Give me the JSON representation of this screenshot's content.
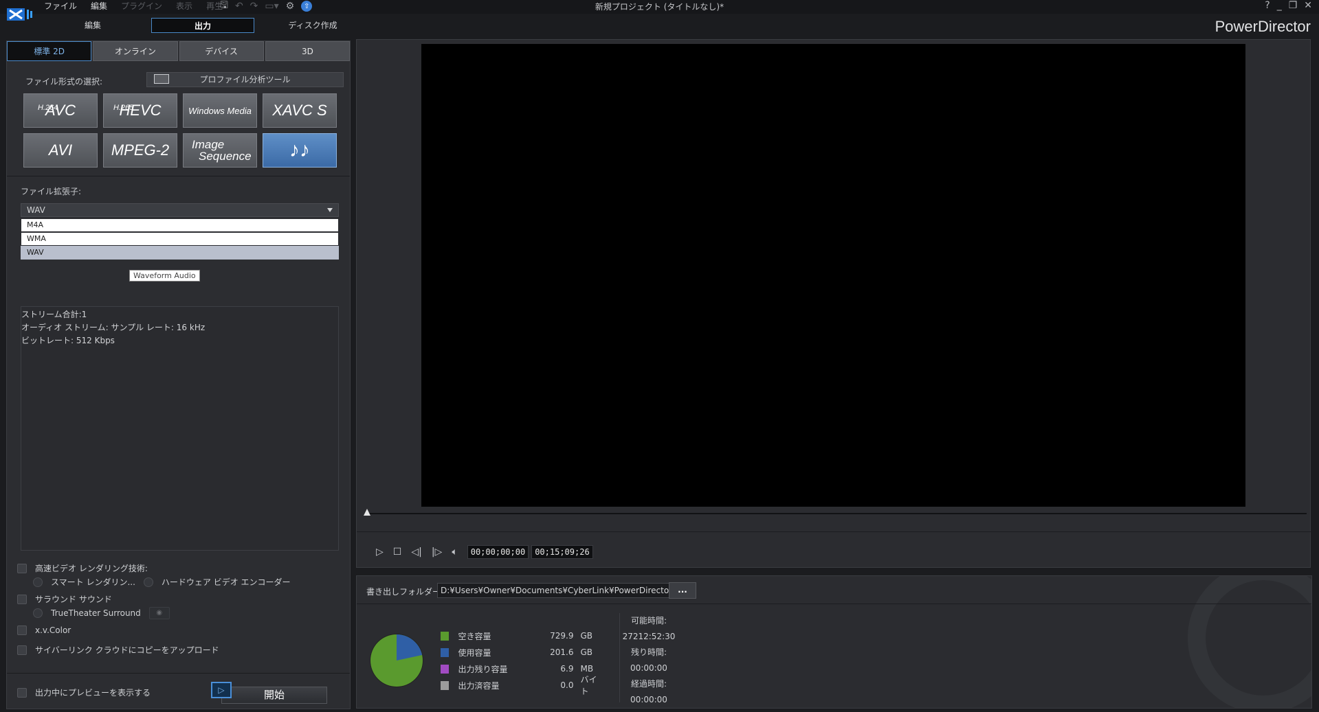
{
  "titlebar": {
    "menu": [
      "ファイル",
      "編集",
      "プラグイン",
      "表示",
      "再生"
    ],
    "document_title": "新規プロジェクト (タイトルなし)*",
    "brand": "PowerDirector",
    "window_buttons": [
      "?",
      "_",
      "❐",
      "✕"
    ]
  },
  "modes": {
    "edit": "編集",
    "produce": "出力",
    "disc": "ディスク作成"
  },
  "tabs": [
    "標準 2D",
    "オンライン",
    "デバイス",
    "3D"
  ],
  "format_section": {
    "label": "ファイル形式の選択:",
    "profile_tool": "プロファイル分析ツール",
    "formats": [
      {
        "sup": "H.264",
        "name": "AVC"
      },
      {
        "sup": "H.265",
        "name": "HEVC"
      },
      {
        "sup": "",
        "name": "Windows Media"
      },
      {
        "sup": "",
        "name": "XAVC S"
      },
      {
        "sup": "",
        "name": "AVI"
      },
      {
        "sup": "",
        "name": "MPEG-2"
      },
      {
        "sup": "",
        "name": "Image",
        "name2": "Sequence"
      },
      {
        "sup": "",
        "name": "♪♪"
      }
    ]
  },
  "extension": {
    "label": "ファイル拡張子:",
    "selected": "WAV",
    "options": [
      "M4A",
      "WMA",
      "WAV"
    ],
    "tooltip": "Waveform Audio"
  },
  "stream_info": [
    "ストリーム合計:1",
    "オーディオ ストリーム: サンプル レート: 16 kHz",
    "ビットレート: 512 Kbps"
  ],
  "options": {
    "fast_render": "高速ビデオ レンダリング技術:",
    "smart_render": "スマート レンダリン...",
    "hw_encoder": "ハードウェア ビデオ エンコーダー",
    "surround": "サラウンド サウンド",
    "truetheater": "TrueTheater Surround",
    "xvcolor": "x.v.Color",
    "cyberlink_cloud": "サイバーリンク クラウドにコピーをアップロード",
    "preview_during": "出力中にプレビューを表示する",
    "start": "開始"
  },
  "player": {
    "current_time": "00;00;00;00",
    "duration": "00;15;09;26"
  },
  "output": {
    "folder_label": "書き出しフォルダー:",
    "folder_path": "D:¥Users¥Owner¥Documents¥CyberLink¥PowerDirecto",
    "browse_label": "...",
    "storage": [
      {
        "name": "空き容量",
        "value": "729.9",
        "unit": "GB",
        "color": "#5a9a2e"
      },
      {
        "name": "使用容量",
        "value": "201.6",
        "unit": "GB",
        "color": "#2f5fa6"
      },
      {
        "name": "出力残り容量",
        "value": "6.9",
        "unit": "MB",
        "color": "#a14bc2"
      },
      {
        "name": "出力済容量",
        "value": "0.0",
        "unit": "バイト",
        "color": "#9c9c9c"
      }
    ],
    "pie_used_fraction": 0.216,
    "time_labels": {
      "possible": "可能時間:",
      "possible_val": "27212:52:30",
      "remaining": "残り時間:",
      "remaining_val": "00:00:00",
      "elapsed": "経過時間:",
      "elapsed_val": "00:00:00"
    }
  }
}
